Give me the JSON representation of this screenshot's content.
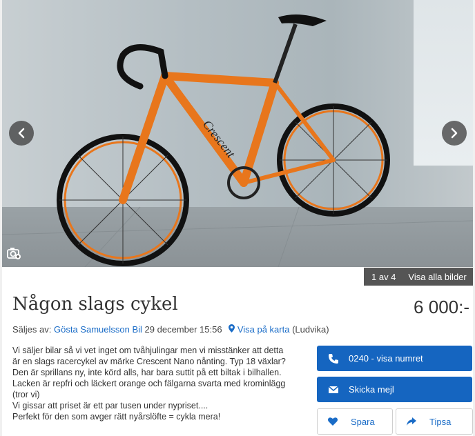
{
  "gallery": {
    "counter": "1 av 4",
    "show_all": "Visa alla bilder",
    "prev_icon": "chevron-left-icon",
    "next_icon": "chevron-right-icon",
    "image_icon": "camera-icon"
  },
  "listing": {
    "title": "Någon slags cykel",
    "price": "6 000:-",
    "seller_prefix": "Säljes av:",
    "seller_name": "Gösta Samuelsson Bil",
    "date": "29 december 15:56",
    "map_link": "Visa på karta",
    "location": "(Ludvika)",
    "description": "Vi säljer bilar så vi vet inget om tvåhjulingar men vi misstänker att detta\när en slags racercykel av märke Crescent Nano nånting. Typ 18 växlar?\nDen är sprillans ny, inte körd alls, har bara suttit på ett biltak i bilhallen.\nLacken är repfri och läckert orange och fälgarna svarta med krominlägg\n(tror vi)\nVi gissar att priset är ett par tusen under nypriset....\nPerfekt för den som avger rätt nyårslöfte = cykla mera!"
  },
  "actions": {
    "phone": "0240 - visa numret",
    "email": "Skicka mejl",
    "save": "Spara",
    "share": "Tipsa"
  },
  "colors": {
    "accent": "#1565c0",
    "link": "#1a6cc7",
    "bike_frame": "#e8761c"
  }
}
